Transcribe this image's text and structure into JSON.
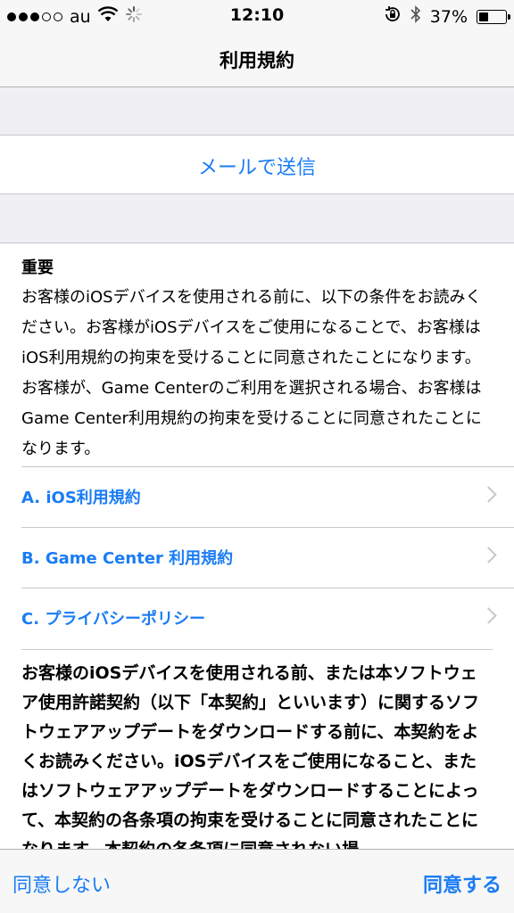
{
  "status_bar": {
    "carrier": "au",
    "time": "12:10",
    "battery_percent": "37%",
    "battery_level": 0.37,
    "signal_filled": 3,
    "signal_total": 5
  },
  "nav": {
    "title": "利用規約"
  },
  "send_email": {
    "label": "メールで送信"
  },
  "intro": {
    "heading": "重要",
    "body": "お客様のiOSデバイスを使用される前に、以下の条件をお読みください。お客様がiOSデバイスをご使用になることで、お客様はiOS利用規約の拘束を受けることに同意されたことになります。お客様が、Game Centerのご利用を選択される場合、お客様はGame Center利用規約の拘束を受けることに同意されたことになります。"
  },
  "links": [
    {
      "label": "A. iOS利用規約"
    },
    {
      "label": "B. Game Center 利用規約"
    },
    {
      "label": "C. プライバシーポリシー"
    }
  ],
  "body_text": "お客様のiOSデバイスを使用される前、または本ソフトウェア使用許諾契約（以下「本契約」といいます）に関するソフトウェアアップデートをダウンロードする前に、本契約をよくお読みください。iOSデバイスをご使用になること、またはソフトウェアアップデートをダウンロードすることによって、本契約の各条項の拘束を受けることに同意されたことになります。本契約の各条項に同意されない場",
  "toolbar": {
    "disagree": "同意しない",
    "agree": "同意する"
  },
  "colors": {
    "accent": "#1a7cf5"
  },
  "icons": {
    "wifi": "wifi-icon",
    "activity": "activity-spinner-icon",
    "rotation_lock": "rotation-lock-icon",
    "bluetooth": "bluetooth-icon",
    "battery": "battery-icon",
    "chevron": "chevron-right-icon"
  }
}
